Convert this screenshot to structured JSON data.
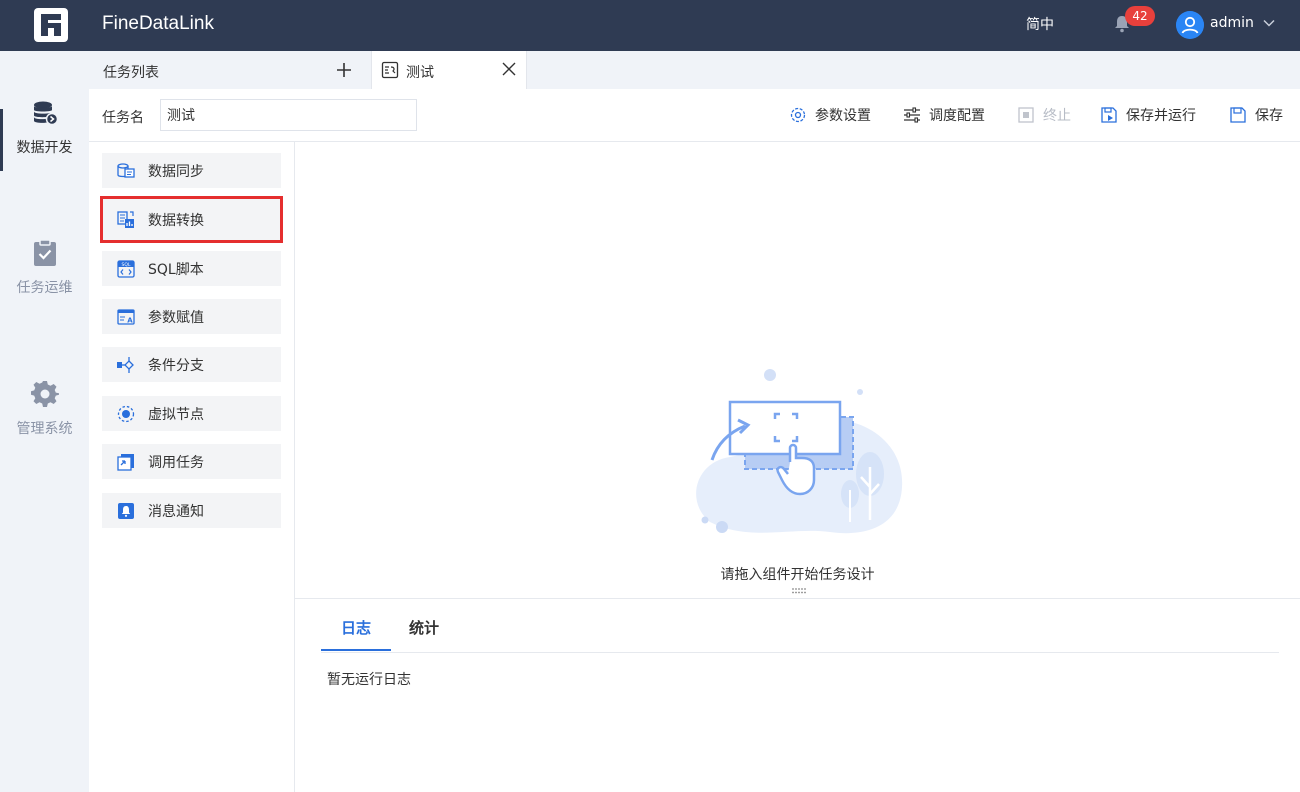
{
  "header": {
    "app_title": "FineDataLink",
    "language": "简中",
    "notification_count": "42",
    "user": "admin"
  },
  "leftnav": {
    "items": [
      {
        "label": "数据开发",
        "icon": "database-icon",
        "active": true
      },
      {
        "label": "任务运维",
        "icon": "clipboard-check-icon",
        "active": false
      },
      {
        "label": "管理系统",
        "icon": "gear-icon",
        "active": false
      }
    ]
  },
  "tabs": {
    "task_list": "任务列表",
    "active_tab": "测试"
  },
  "toolbar": {
    "task_name_label": "任务名",
    "task_name_value": "测试",
    "param_settings": "参数设置",
    "schedule_config": "调度配置",
    "stop": "终止",
    "save_and_run": "保存并运行",
    "save": "保存"
  },
  "components": [
    {
      "label": "数据同步",
      "icon": "data-sync-icon"
    },
    {
      "label": "数据转换",
      "icon": "data-transform-icon",
      "highlighted": true
    },
    {
      "label": "SQL脚本",
      "icon": "sql-script-icon"
    },
    {
      "label": "参数赋值",
      "icon": "param-assign-icon"
    },
    {
      "label": "条件分支",
      "icon": "condition-branch-icon"
    },
    {
      "label": "虚拟节点",
      "icon": "virtual-node-icon"
    },
    {
      "label": "调用任务",
      "icon": "invoke-task-icon"
    },
    {
      "label": "消息通知",
      "icon": "message-notify-icon"
    }
  ],
  "canvas": {
    "empty_hint": "请拖入组件开始任务设计"
  },
  "bottom": {
    "tabs": [
      "日志",
      "统计"
    ],
    "log_empty": "暂无运行日志"
  },
  "colors": {
    "header_bg": "#2f3b53",
    "accent": "#2a6fdc",
    "highlight_border": "#e52e2e",
    "badge": "#e8403c"
  }
}
